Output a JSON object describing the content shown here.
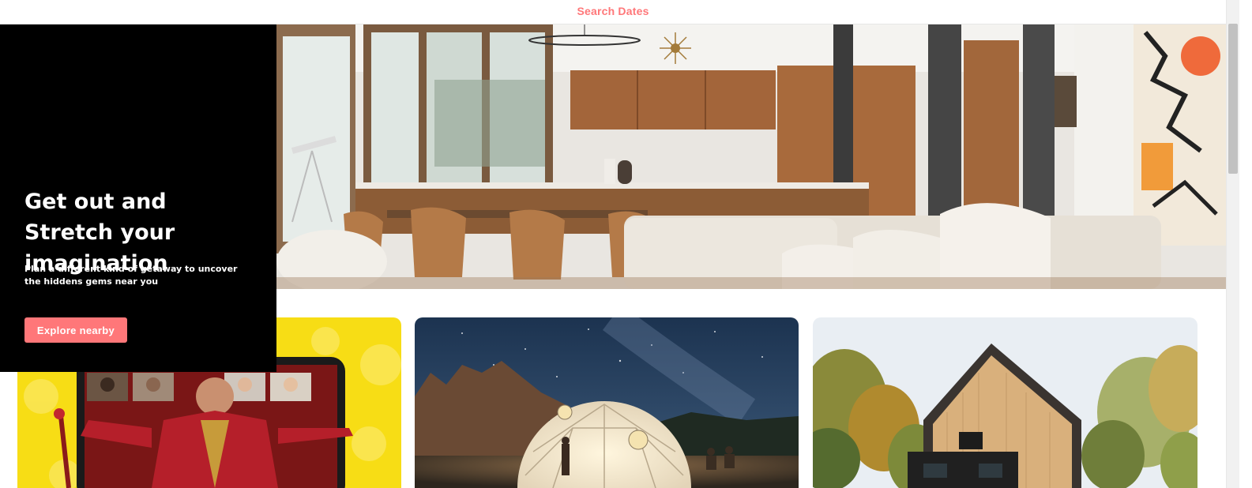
{
  "header": {
    "search_dates_label": "Search Dates"
  },
  "hero": {
    "title": "Get out and Stretch your imagination",
    "subtitle": "Plan a different kind of getaway to uncover the hiddens gems near you",
    "cta_label": "Explore nearby"
  },
  "cards": [
    {
      "image": "online-experience-ringmaster-video-call"
    },
    {
      "image": "glowing-geodesic-dome-under-night-sky"
    },
    {
      "image": "modern-wooden-a-frame-cabin-in-forest"
    }
  ],
  "colors": {
    "accent": "#ff7779",
    "hero_panel": "#000000",
    "page_bg": "#ffffff"
  }
}
